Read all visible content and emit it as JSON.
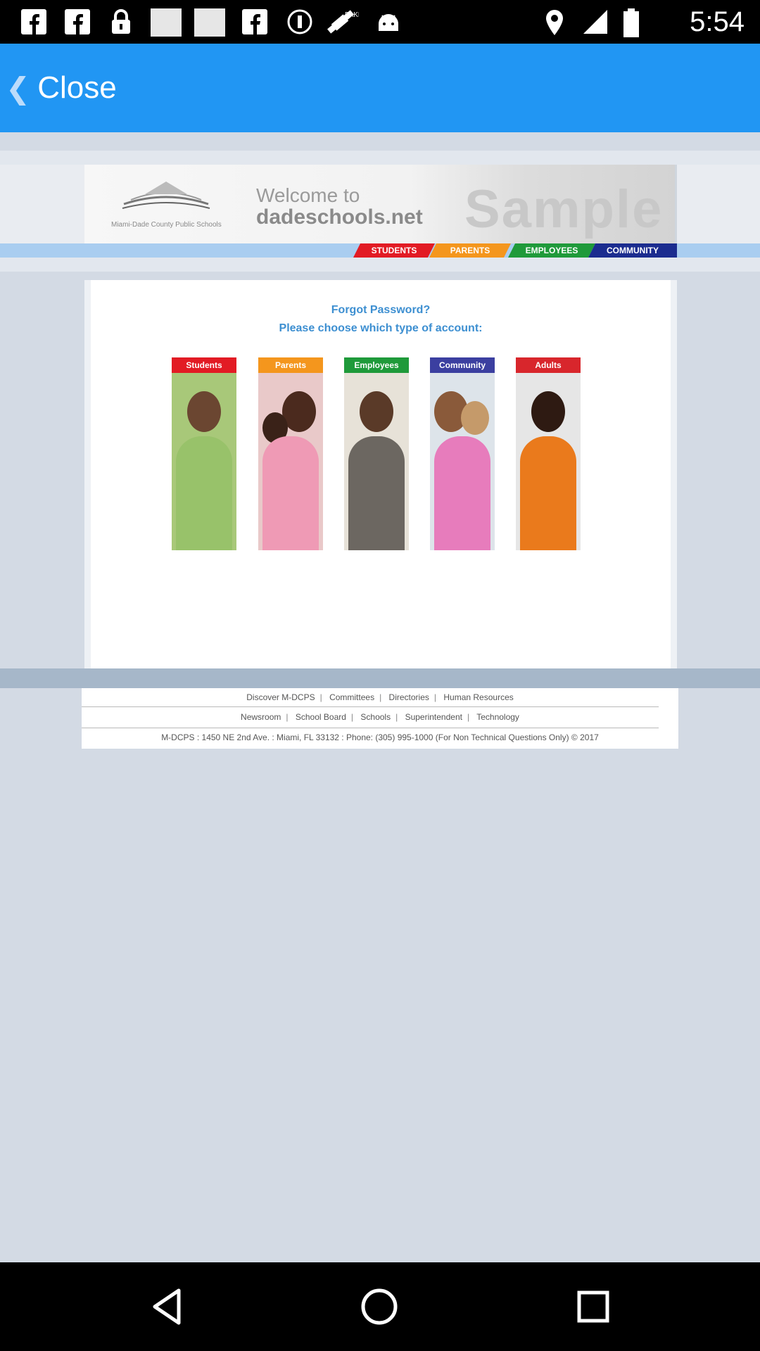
{
  "status_bar": {
    "time": "5:54",
    "icons": [
      "facebook-icon",
      "facebook-icon",
      "lock-icon",
      "image-placeholder-icon",
      "image-placeholder-icon",
      "facebook-icon",
      "info-icon",
      "satellite-icon",
      "android-icon",
      "location-icon",
      "signal-icon",
      "battery-icon"
    ]
  },
  "app_bar": {
    "close_label": "Close",
    "back_icon": "chevron-left-icon"
  },
  "web": {
    "header": {
      "logo_text": "Miami-Dade County Public Schools",
      "welcome_line1": "Welcome to",
      "welcome_line2": "dadeschools.net",
      "watermark": "Sample",
      "nav_tabs": [
        {
          "label": "STUDENTS",
          "color": "#e21b24"
        },
        {
          "label": "PARENTS",
          "color": "#f4961d"
        },
        {
          "label": "EMPLOYEES",
          "color": "#1f9a3a"
        },
        {
          "label": "COMMUNITY",
          "color": "#1b2c8f"
        }
      ]
    },
    "main": {
      "title": "Forgot Password?",
      "subtitle": "Please choose which type of account:",
      "accounts": [
        {
          "label": "Students",
          "color": "#e21b24"
        },
        {
          "label": "Parents",
          "color": "#f4961d"
        },
        {
          "label": "Employees",
          "color": "#1f9a3a"
        },
        {
          "label": "Community",
          "color": "#3b3fa0"
        },
        {
          "label": "Adults",
          "color": "#d8262c"
        }
      ]
    },
    "footer": {
      "row1": [
        "Discover M-DCPS",
        "Committees",
        "Directories",
        "Human Resources"
      ],
      "row2": [
        "Newsroom",
        "School Board",
        "Schools",
        "Superintendent",
        "Technology"
      ],
      "address": "M-DCPS : 1450 NE 2nd Ave. : Miami, FL 33132 : Phone: (305) 995-1000 (For Non Technical Questions Only) © 2017"
    }
  },
  "nav_bar": {
    "icons": [
      "back-triangle-icon",
      "home-circle-icon",
      "recents-square-icon"
    ]
  }
}
